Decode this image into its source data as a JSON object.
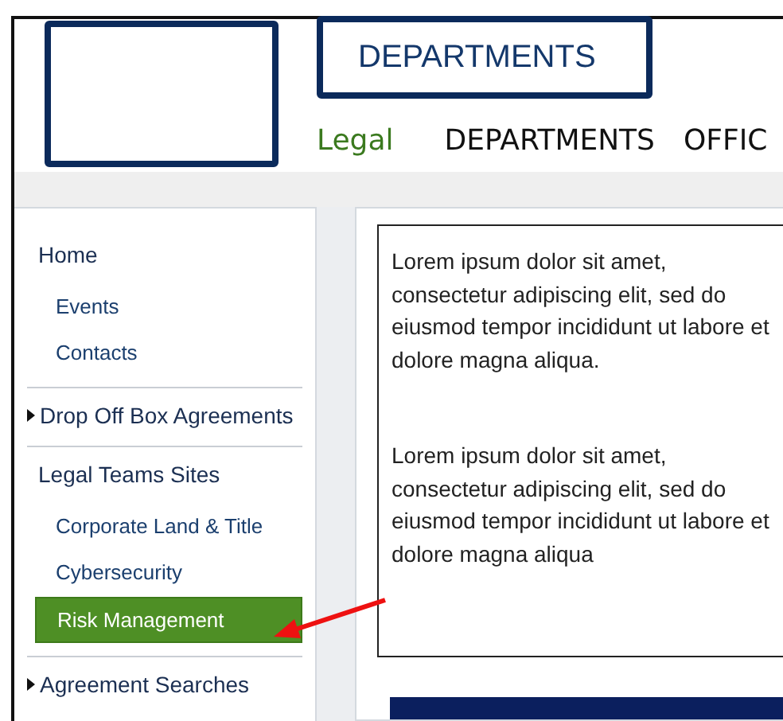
{
  "logo_box": {
    "kind": "placeholder"
  },
  "department_box": {
    "label": "DEPARTMENTS"
  },
  "nav": [
    {
      "label": "Legal",
      "selected": true
    },
    {
      "label": "DEPARTMENTS",
      "selected": false
    },
    {
      "label": "OFFIC",
      "selected": false
    }
  ],
  "sidebar": {
    "sections": [
      {
        "label": "Home",
        "kind": "link",
        "children": [
          {
            "label": "Events",
            "selected": false
          },
          {
            "label": "Contacts",
            "selected": false
          }
        ]
      },
      {
        "label": "Drop Off Box Agreements",
        "kind": "collapsible"
      },
      {
        "label": "Legal Teams Sites",
        "kind": "link",
        "children": [
          {
            "label": "Corporate Land & Title",
            "selected": false
          },
          {
            "label": "Cybersecurity",
            "selected": false
          },
          {
            "label": "Risk Management",
            "selected": true
          }
        ]
      },
      {
        "label": "Agreement Searches",
        "kind": "collapsible"
      }
    ]
  },
  "content": {
    "paragraphs": [
      "Lorem ipsum dolor sit amet, consectetur adipiscing elit, sed do eiusmod tempor incididunt ut labore et dolore magna aliqua.",
      "Lorem ipsum dolor sit amet, consectetur adipiscing elit, sed do eiusmod tempor incididunt ut labore et dolore magna aliqua"
    ]
  },
  "annotation": {
    "kind": "arrow"
  }
}
